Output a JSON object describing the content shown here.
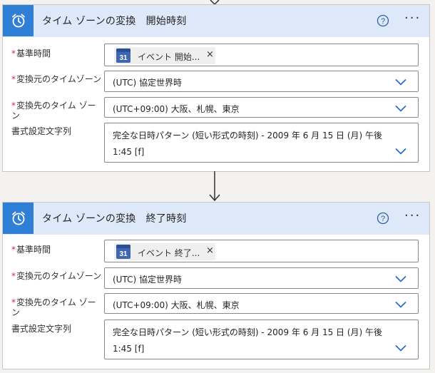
{
  "cards": [
    {
      "title": "タイム ゾーンの変換　開始時刻",
      "icon": "alarm-clock-icon",
      "help_icon": "help-circle-icon",
      "more_label": "···",
      "fields": {
        "base_time_label": "基準時間",
        "base_time_token": "イベント 開始...",
        "base_time_token_remove": "×",
        "source_tz_label": "変換元のタイムゾーン",
        "source_tz_value": "(UTC) 協定世界時",
        "dest_tz_label": "変換先のタイム ゾーン",
        "dest_tz_value": "(UTC+09:00) 大阪、札幌、東京",
        "format_label": "書式設定文字列",
        "format_value_line1": "完全な日時パターン (短い形式の時刻) - 2009 年 6 月 15 日 (月) 午後",
        "format_value_line2": "1:45 [f]"
      }
    },
    {
      "title": "タイム ゾーンの変換　終了時刻",
      "icon": "alarm-clock-icon",
      "help_icon": "help-circle-icon",
      "more_label": "···",
      "fields": {
        "base_time_label": "基準時間",
        "base_time_token": "イベント 終了...",
        "base_time_token_remove": "×",
        "source_tz_label": "変換元のタイムゾーン",
        "source_tz_value": "(UTC) 協定世界時",
        "dest_tz_label": "変換先のタイム ゾーン",
        "dest_tz_value": "(UTC+09:00) 大阪、札幌、東京",
        "format_label": "書式設定文字列",
        "format_value_line1": "完全な日時パターン (短い形式の時刻) - 2009 年 6 月 15 日 (月) 午後",
        "format_value_line2": "1:45 [f]"
      }
    }
  ],
  "token_icon_text": "31",
  "required_marker": "*",
  "colors": {
    "header_bg": "#dde9f9",
    "icon_bg": "#2f7fd6",
    "required": "#c4314b",
    "chevron": "#1e67c9",
    "canvas_bg": "#f3f2f1"
  }
}
